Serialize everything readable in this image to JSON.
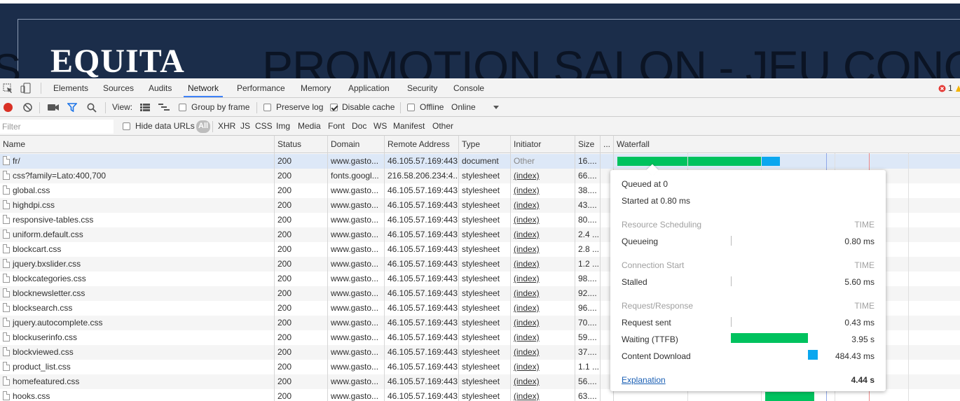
{
  "site": {
    "logo": "EQUITA",
    "headline": "PROMOTION SALON - JEU CONCOURS",
    "left_glyph": "S"
  },
  "devtools": {
    "tabs": [
      "Elements",
      "Sources",
      "Audits",
      "Network",
      "Performance",
      "Memory",
      "Application",
      "Security",
      "Console"
    ],
    "active_tab": "Network",
    "error_count": "1",
    "toolbar": {
      "view_label": "View:",
      "group_by_frame": "Group by frame",
      "preserve_log": "Preserve log",
      "disable_cache": "Disable cache",
      "offline": "Offline",
      "throttle": "Online"
    },
    "filter": {
      "placeholder": "Filter",
      "hide_data_urls": "Hide data URLs",
      "types": [
        "All",
        "XHR",
        "JS",
        "CSS",
        "Img",
        "Media",
        "Font",
        "Doc",
        "WS",
        "Manifest",
        "Other"
      ]
    },
    "columns": [
      "Name",
      "Status",
      "Domain",
      "Remote Address",
      "Type",
      "Initiator",
      "Size",
      "...",
      "Waterfall"
    ],
    "rows": [
      {
        "name": "fr/",
        "status": "200",
        "domain": "www.gasto...",
        "remote": "46.105.57.169:443",
        "type": "document",
        "initiator": "Other",
        "size": "16...."
      },
      {
        "name": "css?family=Lato:400,700",
        "status": "200",
        "domain": "fonts.googl...",
        "remote": "216.58.206.234:4...",
        "type": "stylesheet",
        "initiator": "(index)",
        "size": "66...."
      },
      {
        "name": "global.css",
        "status": "200",
        "domain": "www.gasto...",
        "remote": "46.105.57.169:443",
        "type": "stylesheet",
        "initiator": "(index)",
        "size": "38...."
      },
      {
        "name": "highdpi.css",
        "status": "200",
        "domain": "www.gasto...",
        "remote": "46.105.57.169:443",
        "type": "stylesheet",
        "initiator": "(index)",
        "size": "43...."
      },
      {
        "name": "responsive-tables.css",
        "status": "200",
        "domain": "www.gasto...",
        "remote": "46.105.57.169:443",
        "type": "stylesheet",
        "initiator": "(index)",
        "size": "80...."
      },
      {
        "name": "uniform.default.css",
        "status": "200",
        "domain": "www.gasto...",
        "remote": "46.105.57.169:443",
        "type": "stylesheet",
        "initiator": "(index)",
        "size": "2.4 ..."
      },
      {
        "name": "blockcart.css",
        "status": "200",
        "domain": "www.gasto...",
        "remote": "46.105.57.169:443",
        "type": "stylesheet",
        "initiator": "(index)",
        "size": "2.8 ..."
      },
      {
        "name": "jquery.bxslider.css",
        "status": "200",
        "domain": "www.gasto...",
        "remote": "46.105.57.169:443",
        "type": "stylesheet",
        "initiator": "(index)",
        "size": "1.2 ..."
      },
      {
        "name": "blockcategories.css",
        "status": "200",
        "domain": "www.gasto...",
        "remote": "46.105.57.169:443",
        "type": "stylesheet",
        "initiator": "(index)",
        "size": "98...."
      },
      {
        "name": "blocknewsletter.css",
        "status": "200",
        "domain": "www.gasto...",
        "remote": "46.105.57.169:443",
        "type": "stylesheet",
        "initiator": "(index)",
        "size": "92...."
      },
      {
        "name": "blocksearch.css",
        "status": "200",
        "domain": "www.gasto...",
        "remote": "46.105.57.169:443",
        "type": "stylesheet",
        "initiator": "(index)",
        "size": "96...."
      },
      {
        "name": "jquery.autocomplete.css",
        "status": "200",
        "domain": "www.gasto...",
        "remote": "46.105.57.169:443",
        "type": "stylesheet",
        "initiator": "(index)",
        "size": "70...."
      },
      {
        "name": "blockuserinfo.css",
        "status": "200",
        "domain": "www.gasto...",
        "remote": "46.105.57.169:443",
        "type": "stylesheet",
        "initiator": "(index)",
        "size": "59...."
      },
      {
        "name": "blockviewed.css",
        "status": "200",
        "domain": "www.gasto...",
        "remote": "46.105.57.169:443",
        "type": "stylesheet",
        "initiator": "(index)",
        "size": "37...."
      },
      {
        "name": "product_list.css",
        "status": "200",
        "domain": "www.gasto...",
        "remote": "46.105.57.169:443",
        "type": "stylesheet",
        "initiator": "(index)",
        "size": "1.1 ..."
      },
      {
        "name": "homefeatured.css",
        "status": "200",
        "domain": "www.gasto...",
        "remote": "46.105.57.169:443",
        "type": "stylesheet",
        "initiator": "(index)",
        "size": "56...."
      },
      {
        "name": "hooks.css",
        "status": "200",
        "domain": "www.gasto...",
        "remote": "46.105.57.169:443",
        "type": "stylesheet",
        "initiator": "(index)",
        "size": "63...."
      }
    ],
    "timing": {
      "queued": "Queued at 0",
      "started": "Started at 0.80 ms",
      "time_label": "TIME",
      "sections": [
        {
          "title": "Resource Scheduling",
          "items": [
            {
              "label": "Queueing",
              "value": "0.80 ms"
            }
          ]
        },
        {
          "title": "Connection Start",
          "items": [
            {
              "label": "Stalled",
              "value": "5.60 ms"
            }
          ]
        },
        {
          "title": "Request/Response",
          "items": [
            {
              "label": "Request sent",
              "value": "0.43 ms"
            },
            {
              "label": "Waiting (TTFB)",
              "value": "3.95 s"
            },
            {
              "label": "Content Download",
              "value": "484.43 ms"
            }
          ]
        }
      ],
      "explanation": "Explanation",
      "total": "4.44 s",
      "waiting_color": "#00c25e",
      "download_color": "#0aa7ef"
    }
  }
}
